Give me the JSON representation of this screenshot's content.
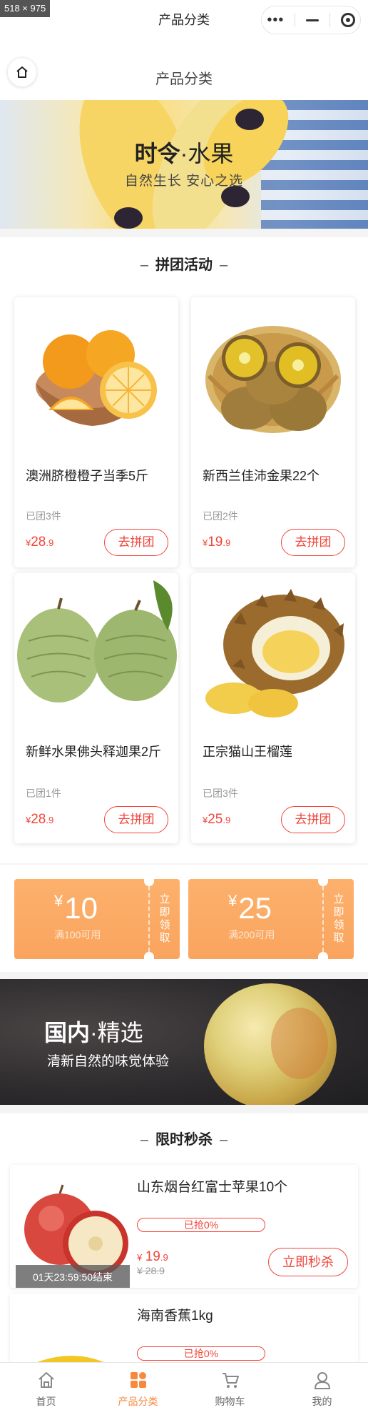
{
  "system": {
    "dimension_badge": "518 × 975",
    "title": "产品分类"
  },
  "navbar": {
    "title": "产品分类",
    "home_icon": "home-icon"
  },
  "banner_seasonal": {
    "title_bold": "时令",
    "title_dot": "·",
    "title_rest": "水果",
    "subtitle": "自然生长 安心之选"
  },
  "group_buy": {
    "section_dash_left": "–",
    "section_title": "拼团活动",
    "section_dash_right": "–",
    "items": [
      {
        "name": "澳洲脐橙橙子当季5斤",
        "grouped": "已团3件",
        "currency": "¥",
        "price_int": "28",
        "price_dec": ".9",
        "button": "去拼团"
      },
      {
        "name": "新西兰佳沛金果22个",
        "grouped": "已团2件",
        "currency": "¥",
        "price_int": "19",
        "price_dec": ".9",
        "button": "去拼团"
      },
      {
        "name": "新鲜水果佛头释迦果2斤",
        "grouped": "已团1件",
        "currency": "¥",
        "price_int": "28",
        "price_dec": ".9",
        "button": "去拼团"
      },
      {
        "name": "正宗猫山王榴莲",
        "grouped": "已团3件",
        "currency": "¥",
        "price_int": "25",
        "price_dec": ".9",
        "button": "去拼团"
      }
    ]
  },
  "coupons": [
    {
      "currency": "¥",
      "amount": "10",
      "condition": "满100可用",
      "action": "立即领取"
    },
    {
      "currency": "¥",
      "amount": "25",
      "condition": "满200可用",
      "action": "立即领取"
    }
  ],
  "banner_domestic": {
    "title_bold": "国内",
    "title_rest": "·精选",
    "subtitle": "清新自然的味觉体验"
  },
  "flash_sale": {
    "section_dash_left": "–",
    "section_title": "限时秒杀",
    "section_dash_right": "–",
    "items": [
      {
        "name": "山东烟台红富士苹果10个",
        "progress_label": "已抢0%",
        "progress": 0,
        "currency": "¥",
        "price_int": "19",
        "price_dec": ".9",
        "original": "¥ 28.9",
        "button": "立即秒杀",
        "countdown": "01天23:59:50结束"
      },
      {
        "name": "海南香蕉1kg",
        "progress_label": "已抢0%",
        "progress": 0
      }
    ]
  },
  "tabbar": {
    "active_color": "#f7893e",
    "items": [
      {
        "label": "首页",
        "icon": "home-icon"
      },
      {
        "label": "产品分类",
        "icon": "category-icon"
      },
      {
        "label": "购物车",
        "icon": "cart-icon"
      },
      {
        "label": "我的",
        "icon": "profile-icon"
      }
    ]
  }
}
